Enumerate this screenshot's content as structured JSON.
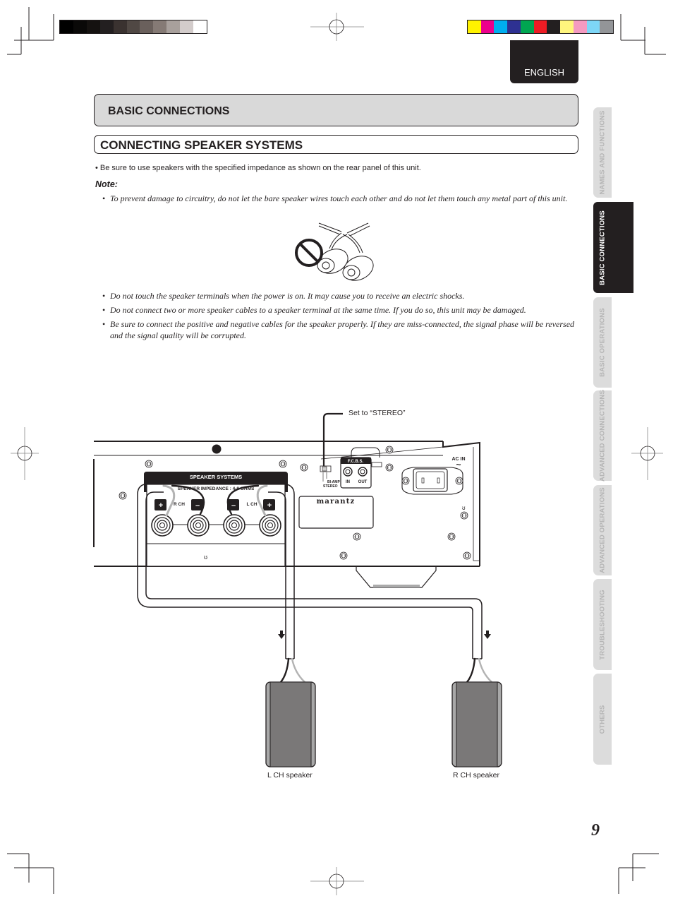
{
  "language_tab": "ENGLISH",
  "section_header": "BASIC CONNECTIONS",
  "subsection_header": "CONNECTING SPEAKER SYSTEMS",
  "intro_bullet": "•  Be sure to use speakers with the specified impedance as shown on the rear panel of this unit.",
  "note": {
    "heading": "Note:",
    "bullets": [
      "To prevent damage to circuitry, do not let the bare speaker wires touch each other and do not let them touch any metal part of this unit.",
      "Do not touch the speaker terminals when the power is on. It may cause you to receive an electric shocks.",
      "Do not connect two or more speaker cables to a speaker terminal at the same time.  If you do so, this unit may be damaged.",
      "Be sure to connect the positive and negative cables for the speaker properly. If they are miss-connected, the signal phase will be reversed and the signal quality will be corrupted."
    ],
    "bullet_glyph": "•"
  },
  "side_tabs": [
    {
      "label": "NAMES AND FUNCTIONS",
      "active": false
    },
    {
      "label": "BASIC CONNECTIONS",
      "active": true
    },
    {
      "label": "BASIC OPERATIONS",
      "active": false
    },
    {
      "label": "ADVANCED CONNECTIONS",
      "active": false
    },
    {
      "label": "ADVANCED OPERATIONS",
      "active": false
    },
    {
      "label": "TROUBLESHOOTING",
      "active": false
    },
    {
      "label": "OTHERS",
      "active": false
    }
  ],
  "diagram": {
    "callout": "Set to “STEREO”",
    "speaker_systems_label": "SPEAKER SYSTEMS",
    "impedance_label": "SPEAKER IMPEDANCE : 4-8 OHMS",
    "r_ch": "R CH",
    "l_ch": "L CH",
    "plus": "+",
    "minus": "–",
    "fcbs": "F.C.B.S.",
    "fcbs_in": "IN",
    "fcbs_out": "OUT",
    "bi_amp": "BI-AMP",
    "stereo": "STEREO",
    "ac_in": "AC IN",
    "ac_symbol": "~",
    "brand": "marantz",
    "l_speaker": "L CH speaker",
    "r_speaker": "R CH speaker"
  },
  "page_number": "9",
  "color_bars": {
    "gray": [
      "#000000",
      "#0a0908",
      "#151210",
      "#231f20",
      "#3a3230",
      "#504844",
      "#6a605c",
      "#857a75",
      "#a8a09c",
      "#d3cccb",
      "#ffffff"
    ],
    "color": [
      "#fff200",
      "#ec008c",
      "#00aeef",
      "#2e3192",
      "#00a651",
      "#ed1c24",
      "#231f20",
      "#fff57d",
      "#f49ac1",
      "#7dd6f7",
      "#939598"
    ]
  }
}
